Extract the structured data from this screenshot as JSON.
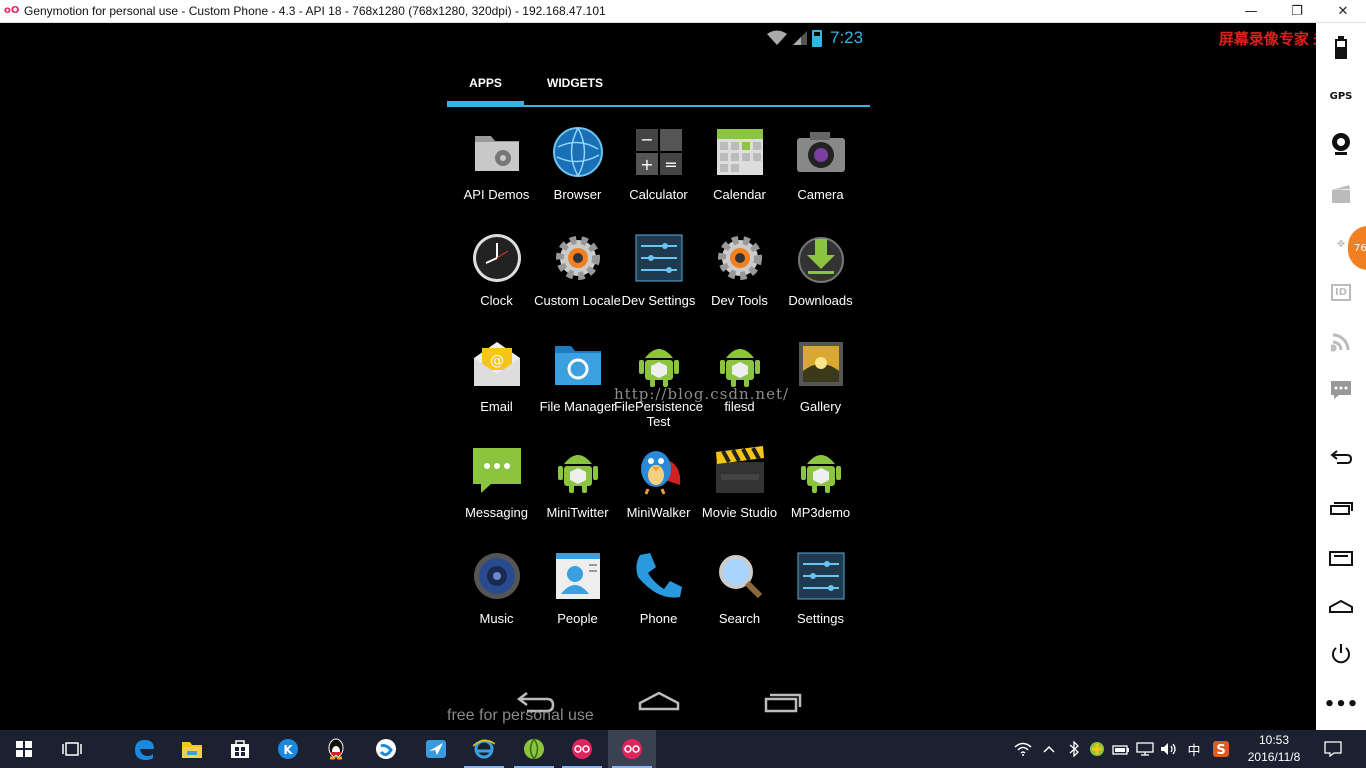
{
  "window": {
    "title": "Genymotion for personal use - Custom Phone - 4.3 - API 18 - 768x1280 (768x1280, 320dpi) - 192.168.47.101",
    "app_icon_text": "oO",
    "minimize": "—",
    "maximize": "❐",
    "close": "✕"
  },
  "status_bar": {
    "time": "7:23"
  },
  "recorder_watermark": "屏幕录像专家 未注册",
  "tabs": [
    {
      "label": "APPS"
    },
    {
      "label": "WIDGETS"
    }
  ],
  "apps": [
    {
      "label": "API Demos",
      "icon": "folder-gear-icon"
    },
    {
      "label": "Browser",
      "icon": "globe-icon"
    },
    {
      "label": "Calculator",
      "icon": "calculator-icon"
    },
    {
      "label": "Calendar",
      "icon": "calendar-icon"
    },
    {
      "label": "Camera",
      "icon": "camera-icon"
    },
    {
      "label": "Clock",
      "icon": "clock-icon"
    },
    {
      "label": "Custom Locale",
      "icon": "gear-icon"
    },
    {
      "label": "Dev Settings",
      "icon": "sliders-icon"
    },
    {
      "label": "Dev Tools",
      "icon": "gear-icon"
    },
    {
      "label": "Downloads",
      "icon": "download-icon"
    },
    {
      "label": "Email",
      "icon": "envelope-icon"
    },
    {
      "label": "File Manager",
      "icon": "folder-icon"
    },
    {
      "label": "FilePersistenceTest",
      "icon": "android-icon"
    },
    {
      "label": "filesd",
      "icon": "android-icon"
    },
    {
      "label": "Gallery",
      "icon": "picture-icon"
    },
    {
      "label": "Messaging",
      "icon": "chat-icon"
    },
    {
      "label": "MiniTwitter",
      "icon": "android-icon"
    },
    {
      "label": "MiniWalker",
      "icon": "bird-icon"
    },
    {
      "label": "Movie Studio",
      "icon": "clapper-icon"
    },
    {
      "label": "MP3demo",
      "icon": "android-icon"
    },
    {
      "label": "Music",
      "icon": "speaker-icon"
    },
    {
      "label": "People",
      "icon": "contact-card-icon"
    },
    {
      "label": "Phone",
      "icon": "phone-icon"
    },
    {
      "label": "Search",
      "icon": "magnifier-icon"
    },
    {
      "label": "Settings",
      "icon": "sliders-icon"
    }
  ],
  "watermarks": {
    "csdn": "http://blog.csdn.net/",
    "personal": "free for personal use"
  },
  "sidebar": {
    "gps_label": "GPS",
    "id_label": "ID",
    "badge": "76"
  },
  "taskbar": {
    "clock_time": "10:53",
    "clock_date": "2016/11/8",
    "ime": "中"
  },
  "colors": {
    "accent": "#33b5e5",
    "watermark_red": "#e02020",
    "taskbar": "#1b2130"
  }
}
